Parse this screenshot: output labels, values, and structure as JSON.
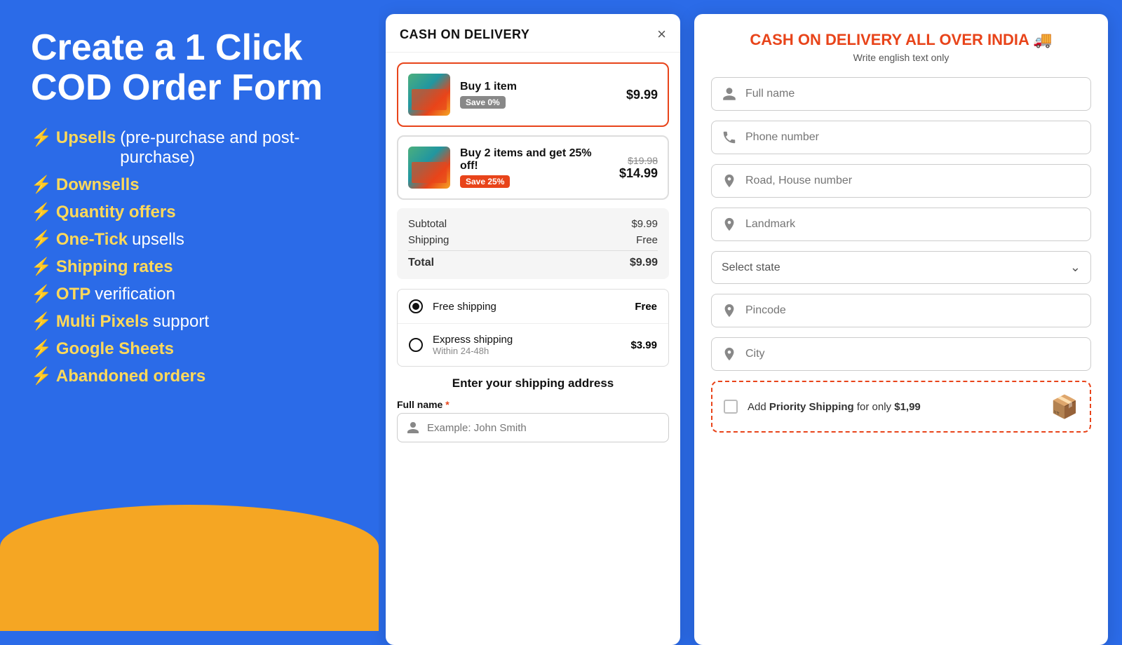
{
  "left": {
    "title": "Create a 1 Click COD Order Form",
    "features": [
      {
        "bold": "Upsells",
        "normal": "(pre-purchase and post-purchase)"
      },
      {
        "bold": "Downsells",
        "normal": ""
      },
      {
        "bold": "Quantity offers",
        "normal": ""
      },
      {
        "bold": "One-Tick",
        "normal": "upsells"
      },
      {
        "bold": "Shipping rates",
        "normal": ""
      },
      {
        "bold": "OTP",
        "normal": "verification"
      },
      {
        "bold": "Multi Pixels",
        "normal": "support"
      },
      {
        "bold": "Google Sheets",
        "normal": ""
      },
      {
        "bold": "Abandoned orders",
        "normal": ""
      }
    ]
  },
  "middle": {
    "header": "CASH ON DELIVERY",
    "close_label": "×",
    "products": [
      {
        "id": "p1",
        "name": "Buy 1 item",
        "badge": "Save 0%",
        "badge_style": "gray",
        "price": "$9.99",
        "old_price": "",
        "selected": true
      },
      {
        "id": "p2",
        "name": "Buy 2 items and get 25% off!",
        "badge": "Save 25%",
        "badge_style": "red",
        "price": "$14.99",
        "old_price": "$19.98",
        "selected": false
      }
    ],
    "summary": {
      "subtotal_label": "Subtotal",
      "subtotal_value": "$9.99",
      "shipping_label": "Shipping",
      "shipping_value": "Free",
      "total_label": "Total",
      "total_value": "$9.99"
    },
    "shipping_options": [
      {
        "id": "free",
        "name": "Free shipping",
        "sub": "",
        "price": "Free",
        "selected": true
      },
      {
        "id": "express",
        "name": "Express shipping",
        "sub": "Within 24-48h",
        "price": "$3.99",
        "selected": false
      }
    ],
    "address_heading": "Enter your shipping address",
    "full_name_label": "Full name",
    "full_name_required": "*",
    "full_name_placeholder": "Example: John Smith"
  },
  "right": {
    "title": "CASH ON DELIVERY ALL OVER INDIA 🚚",
    "subtitle": "Write english text only",
    "fields": [
      {
        "id": "fullname",
        "placeholder": "Full name",
        "icon": "person"
      },
      {
        "id": "phone",
        "placeholder": "Phone number",
        "icon": "phone"
      },
      {
        "id": "road",
        "placeholder": "Road, House number",
        "icon": "location"
      },
      {
        "id": "landmark",
        "placeholder": "Landmark",
        "icon": "location"
      },
      {
        "id": "pincode",
        "placeholder": "Pincode",
        "icon": "location"
      },
      {
        "id": "city",
        "placeholder": "City",
        "icon": "location"
      }
    ],
    "select_state_label": "Select state",
    "priority": {
      "label_before": "Add ",
      "label_bold": "Priority Shipping",
      "label_after": " for only ",
      "price_bold": "$1,99",
      "icon": "📦"
    }
  }
}
